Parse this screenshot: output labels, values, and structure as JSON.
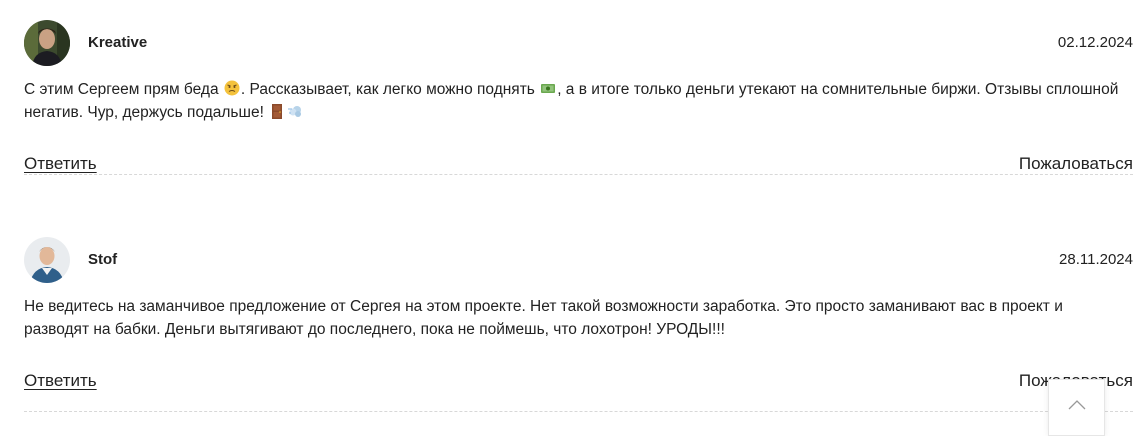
{
  "comments": [
    {
      "author": "Kreative",
      "date": "02.12.2024",
      "text_part1": "С этим Сергеем прям беда ",
      "text_part2": ". Рассказывает, как легко можно поднять ",
      "text_part3": ", а в итоге только деньги утекают на сомнительные биржи. Отзывы сплошной негатив. Чур, держусь подальше! ",
      "emojis": [
        "angry-face-emoji",
        "money-emoji",
        "door-emoji",
        "dash-emoji"
      ],
      "reply_label": "Ответить",
      "report_label": "Пожаловаться"
    },
    {
      "author": "Stof",
      "date": "28.11.2024",
      "text": "Не ведитесь на заманчивое предложение от Сергея на этом проекте. Нет такой возможности заработка. Это просто заманивают вас в проект и разводят на бабки. Деньги вытягивают до последнего, пока не поймешь, что лохотрон! УРОДЫ!!!",
      "reply_label": "Ответить",
      "report_label": "Пожаловаться"
    }
  ],
  "scroll_top": {
    "icon": "chevron-up-icon"
  },
  "colors": {
    "text": "#222222",
    "divider": "#d8d8d8",
    "background": "#ffffff"
  }
}
